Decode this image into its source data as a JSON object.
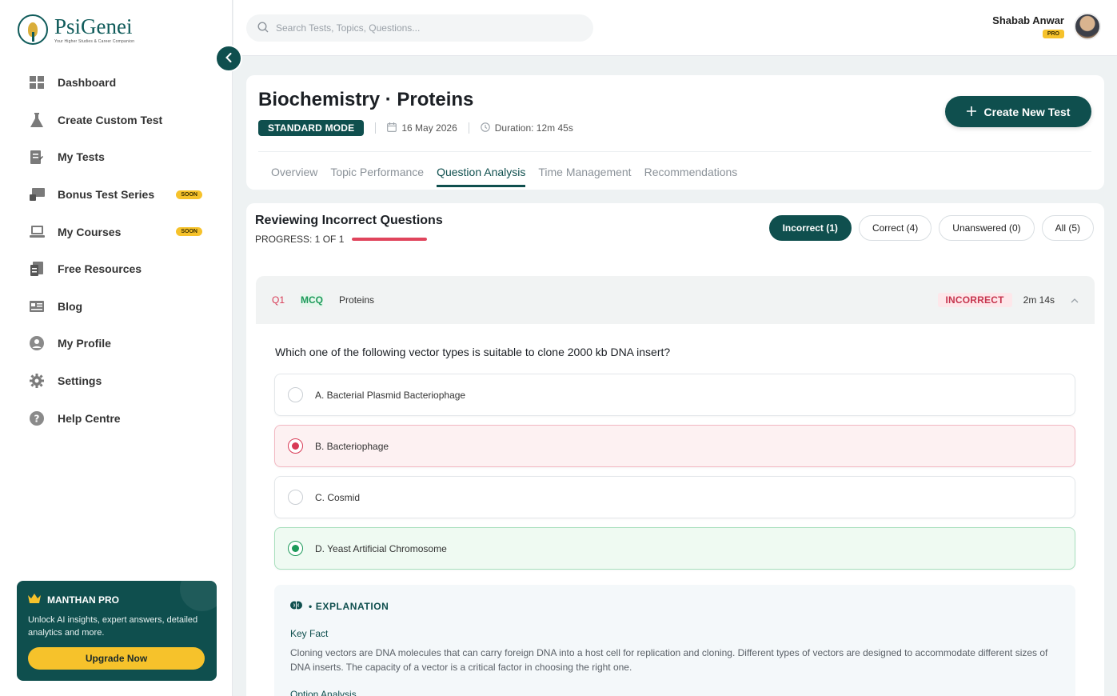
{
  "brand": {
    "name": "PsiGenei",
    "tagline": "Your Higher Studies & Career Companion"
  },
  "sidebar": {
    "items": [
      {
        "label": "Dashboard",
        "icon": "grid-icon",
        "badge": ""
      },
      {
        "label": "Create Custom Test",
        "icon": "flask-icon",
        "badge": ""
      },
      {
        "label": "My Tests",
        "icon": "clipboard-icon",
        "badge": ""
      },
      {
        "label": "Bonus Test Series",
        "icon": "screen-icon",
        "badge": "SOON"
      },
      {
        "label": "My Courses",
        "icon": "laptop-icon",
        "badge": "SOON"
      },
      {
        "label": "Free Resources",
        "icon": "document-icon",
        "badge": ""
      },
      {
        "label": "Blog",
        "icon": "blog-icon",
        "badge": ""
      },
      {
        "label": "My Profile",
        "icon": "user-icon",
        "badge": ""
      },
      {
        "label": "Settings",
        "icon": "gear-icon",
        "badge": ""
      },
      {
        "label": "Help Centre",
        "icon": "help-icon",
        "badge": ""
      }
    ],
    "promo": {
      "title": "MANTHAN PRO",
      "description": "Unlock AI insights, expert answers, detailed analytics and more.",
      "button": "Upgrade Now"
    }
  },
  "topbar": {
    "search_placeholder": "Search Tests, Topics, Questions...",
    "user_name": "Shabab Anwar",
    "user_badge": "PRO"
  },
  "header": {
    "title": "Biochemistry · Proteins",
    "mode": "STANDARD MODE",
    "date": "16 May 2026",
    "duration": "Duration: 12m 45s",
    "create_button": "Create New Test",
    "tabs": [
      "Overview",
      "Topic Performance",
      "Question Analysis",
      "Time Management",
      "Recommendations"
    ],
    "active_tab": "Question Analysis"
  },
  "review": {
    "title": "Reviewing Incorrect Questions",
    "progress_text": "PROGRESS: 1 OF 1",
    "progress_fraction": 1.0,
    "filters": [
      "Incorrect (1)",
      "Correct (4)",
      "Unanswered (0)",
      "All (5)"
    ],
    "active_filter": "Incorrect (1)"
  },
  "question": {
    "number": "Q1",
    "type": "MCQ",
    "topic": "Proteins",
    "status": "INCORRECT",
    "time": "2m 14s",
    "text": "Which one of the following vector types is suitable to clone 2000 kb DNA insert?",
    "options": [
      {
        "label": "A. Bacterial Plasmid Bacteriophage",
        "state": "none"
      },
      {
        "label": "B. Bacteriophage",
        "state": "selected-wrong"
      },
      {
        "label": "C. Cosmid",
        "state": "none"
      },
      {
        "label": "D. Yeast Artificial Chromosome",
        "state": "correct"
      }
    ],
    "explanation": {
      "title": "• EXPLANATION",
      "key_fact_label": "Key Fact",
      "key_fact": "Cloning vectors are DNA molecules that can carry foreign DNA into a host cell for replication and cloning. Different types of vectors are designed to accommodate different sizes of DNA inserts. The capacity of a vector is a critical factor in choosing the right one.",
      "option_analysis_label": "Option Analysis"
    }
  },
  "colors": {
    "primary": "#0f4f4e",
    "accent": "#f6c22b",
    "wrong": "#d83b56",
    "correct": "#1d9a5a"
  }
}
